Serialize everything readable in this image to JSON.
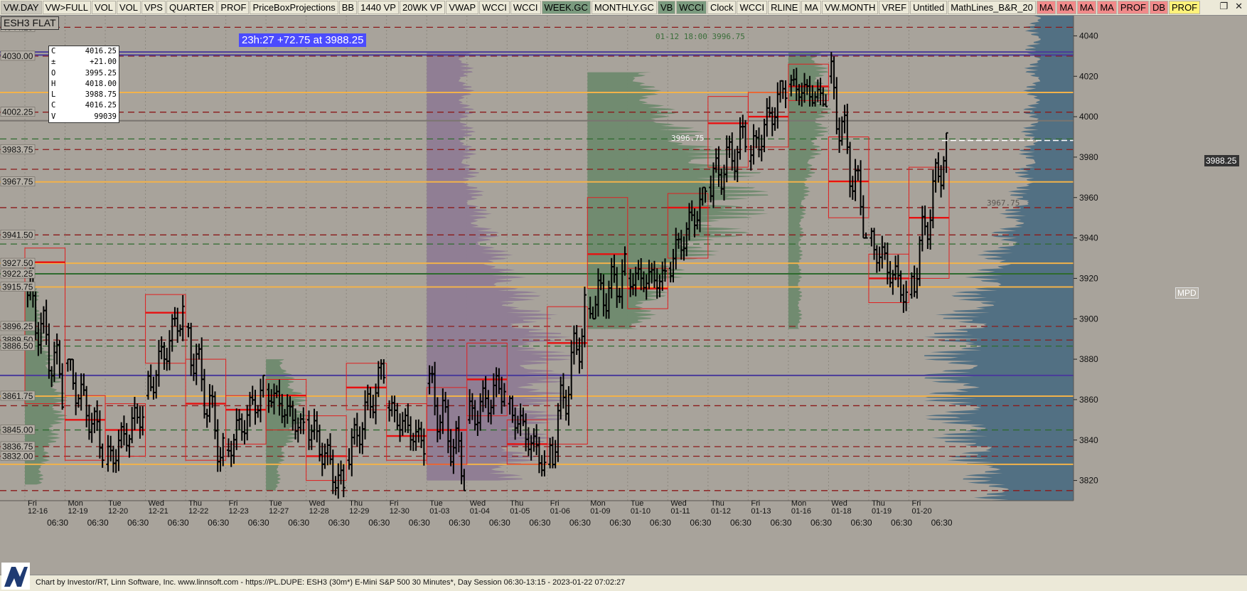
{
  "toolbar": {
    "buttons": [
      {
        "label": "VW.DAY",
        "state": "sel"
      },
      {
        "label": "VW>FULL",
        "state": ""
      },
      {
        "label": "VOL",
        "state": ""
      },
      {
        "label": "VOL",
        "state": ""
      },
      {
        "label": "VPS",
        "state": ""
      },
      {
        "label": "QUARTER",
        "state": ""
      },
      {
        "label": "PROF",
        "state": ""
      },
      {
        "label": "PriceBoxProjections",
        "state": ""
      },
      {
        "label": "BB",
        "state": ""
      },
      {
        "label": "1440 VP",
        "state": ""
      },
      {
        "label": "20WK VP",
        "state": ""
      },
      {
        "label": "VWAP",
        "state": ""
      },
      {
        "label": "WCCI",
        "state": ""
      },
      {
        "label": "WCCI",
        "state": ""
      },
      {
        "label": "WEEK.GC",
        "state": "on"
      },
      {
        "label": "MONTHLY.GC",
        "state": ""
      },
      {
        "label": "VB",
        "state": "on"
      },
      {
        "label": "WCCI",
        "state": "on"
      },
      {
        "label": "Clock",
        "state": ""
      },
      {
        "label": "WCCI",
        "state": ""
      },
      {
        "label": "RLINE",
        "state": ""
      },
      {
        "label": "MA",
        "state": ""
      },
      {
        "label": "VW.MONTH",
        "state": ""
      },
      {
        "label": "VREF",
        "state": ""
      },
      {
        "label": "Untitled",
        "state": ""
      },
      {
        "label": "MathLines_B&R_20",
        "state": ""
      },
      {
        "label": "MA",
        "state": "red"
      },
      {
        "label": "MA",
        "state": "red"
      },
      {
        "label": "MA",
        "state": "red"
      },
      {
        "label": "MA",
        "state": "red"
      },
      {
        "label": "PROF",
        "state": "red"
      },
      {
        "label": "DB",
        "state": "red"
      },
      {
        "label": "PROF",
        "state": "yel"
      }
    ],
    "window_icons": [
      "restore-icon",
      "close-icon"
    ],
    "window_glyphs": [
      "❐",
      "✕"
    ]
  },
  "symbol": "ESH3 FLAT",
  "banner": "23h:27  +72.75 at 3988.25",
  "header_note": "01-12 18:00 3996.75",
  "poc_note": "3996.75",
  "hl_note": "3967.75",
  "mpd_label": "MPD",
  "last_price": "3988.25",
  "info_box": [
    {
      "k": "C",
      "v": "4016.25"
    },
    {
      "k": "±",
      "v": "+21.00"
    },
    {
      "k": "O",
      "v": "3995.25"
    },
    {
      "k": "H",
      "v": "4018.00"
    },
    {
      "k": "L",
      "v": "3988.75"
    },
    {
      "k": "C",
      "v": "4016.25"
    },
    {
      "k": "V",
      "v": "99039"
    }
  ],
  "footer": "Chart by Investor/RT, Linn Software, Inc. www.linnsoft.com - https://PL.DUPE: ESH3 (30m*) E-Mini S&P 500 30 Minutes*, Day Session 06:30-13:15 - 2023-01-22 07:02:27",
  "colors": {
    "background": "#a8a39b",
    "candle": "#000000",
    "poc_red": "#e81010",
    "value_area_orange": "#f2b24a",
    "purple": "#4a3b9a",
    "profile_purple": "#8e7c94",
    "profile_green": "#6e8a6e",
    "profile_blue": "#4d6e82"
  },
  "chart_data": {
    "type": "candlestick",
    "title": "ESH3 (30m*) E-Mini S&P 500 30 Minutes*",
    "ylim": [
      3810,
      4050
    ],
    "y_ticks": [
      3820,
      3840,
      3860,
      3880,
      3900,
      3920,
      3940,
      3960,
      3980,
      4000,
      4020,
      4040
    ],
    "left_price_labels": [
      {
        "text": "4044.25",
        "y": 4044.25
      },
      {
        "text": "4030.00",
        "y": 4030.0
      },
      {
        "text": "4002.25",
        "y": 4002.25
      },
      {
        "text": "3983.75",
        "y": 3983.75
      },
      {
        "text": "3967.75",
        "y": 3967.75
      },
      {
        "text": "3941.50",
        "y": 3941.5
      },
      {
        "text": "3927.50",
        "y": 3927.5
      },
      {
        "text": "3922.25",
        "y": 3922.25
      },
      {
        "text": "3915.75",
        "y": 3915.75
      },
      {
        "text": "3896.25",
        "y": 3896.25
      },
      {
        "text": "3889.50",
        "y": 3889.5
      },
      {
        "text": "3886.50",
        "y": 3886.5
      },
      {
        "text": "3861.75",
        "y": 3861.75
      },
      {
        "text": "3845.00",
        "y": 3845.0
      },
      {
        "text": "3836.75",
        "y": 3836.75
      },
      {
        "text": "3832.00",
        "y": 3832.0
      }
    ],
    "days": [
      {
        "day": "Fri",
        "date": "12-16",
        "o": 3915,
        "c": 3868,
        "lo": 3855,
        "hi": 3945,
        "poc": 3928,
        "vah": 3935,
        "val": 3858
      },
      {
        "day": "Mon",
        "date": "12-19",
        "o": 3878,
        "c": 3838,
        "lo": 3820,
        "hi": 3880,
        "poc": 3850,
        "vah": 3862,
        "val": 3830
      },
      {
        "day": "Tue",
        "date": "12-20",
        "o": 3828,
        "c": 3855,
        "lo": 3815,
        "hi": 3865,
        "poc": 3845,
        "vah": 3858,
        "val": 3832
      },
      {
        "day": "Wed",
        "date": "12-21",
        "o": 3862,
        "c": 3905,
        "lo": 3860,
        "hi": 3915,
        "poc": 3903,
        "vah": 3912,
        "val": 3878
      },
      {
        "day": "Thu",
        "date": "12-22",
        "o": 3896,
        "c": 3832,
        "lo": 3812,
        "hi": 3898,
        "poc": 3858,
        "vah": 3880,
        "val": 3830
      },
      {
        "day": "Fri",
        "date": "12-23",
        "o": 3835,
        "c": 3865,
        "lo": 3822,
        "hi": 3872,
        "poc": 3855,
        "vah": 3862,
        "val": 3838
      },
      {
        "day": "Tue",
        "date": "12-27",
        "o": 3865,
        "c": 3845,
        "lo": 3838,
        "hi": 3873,
        "poc": 3862,
        "vah": 3870,
        "val": 3845
      },
      {
        "day": "Wed",
        "date": "12-28",
        "o": 3850,
        "c": 3815,
        "lo": 3808,
        "hi": 3862,
        "poc": 3832,
        "vah": 3852,
        "val": 3820
      },
      {
        "day": "Thu",
        "date": "12-29",
        "o": 3830,
        "c": 3875,
        "lo": 3820,
        "hi": 3880,
        "poc": 3866,
        "vah": 3878,
        "val": 3855
      },
      {
        "day": "Fri",
        "date": "12-30",
        "o": 3856,
        "c": 3838,
        "lo": 3825,
        "hi": 3862,
        "poc": 3842,
        "vah": 3858,
        "val": 3830
      },
      {
        "day": "Tue",
        "date": "01-03",
        "o": 3868,
        "c": 3826,
        "lo": 3815,
        "hi": 3900,
        "poc": 3845,
        "vah": 3866,
        "val": 3828
      },
      {
        "day": "Wed",
        "date": "01-04",
        "o": 3850,
        "c": 3868,
        "lo": 3838,
        "hi": 3895,
        "poc": 3870,
        "vah": 3888,
        "val": 3852
      },
      {
        "day": "Thu",
        "date": "01-05",
        "o": 3858,
        "c": 3828,
        "lo": 3822,
        "hi": 3862,
        "poc": 3838,
        "vah": 3850,
        "val": 3828
      },
      {
        "day": "Fri",
        "date": "01-06",
        "o": 3828,
        "c": 3902,
        "lo": 3826,
        "hi": 3918,
        "poc": 3888,
        "vah": 3906,
        "val": 3838
      },
      {
        "day": "Mon",
        "date": "01-09",
        "o": 3905,
        "c": 3922,
        "lo": 3900,
        "hi": 3972,
        "poc": 3932,
        "vah": 3960,
        "val": 3915
      },
      {
        "day": "Tue",
        "date": "01-10",
        "o": 3920,
        "c": 3920,
        "lo": 3896,
        "hi": 3930,
        "poc": 3915,
        "vah": 3925,
        "val": 3905
      },
      {
        "day": "Wed",
        "date": "01-11",
        "o": 3925,
        "c": 3962,
        "lo": 3918,
        "hi": 3965,
        "poc": 3955,
        "vah": 3962,
        "val": 3930
      },
      {
        "day": "Thu",
        "date": "01-12",
        "o": 3965,
        "c": 3990,
        "lo": 3948,
        "hi": 4018,
        "poc": 3996.75,
        "vah": 4010,
        "val": 3975
      },
      {
        "day": "Fri",
        "date": "01-13",
        "o": 3978,
        "c": 4016,
        "lo": 3966,
        "hi": 4018,
        "poc": 4000,
        "vah": 4012,
        "val": 3985
      },
      {
        "day": "Mon",
        "date": "01-16",
        "o": 4016,
        "c": 4008,
        "lo": 4005,
        "hi": 4034,
        "poc": 4015,
        "vah": 4026,
        "val": 4008
      },
      {
        "day": "Wed",
        "date": "01-18",
        "o": 4020,
        "c": 3945,
        "lo": 3940,
        "hi": 4032,
        "poc": 3968,
        "vah": 3990,
        "val": 3950
      },
      {
        "day": "Thu",
        "date": "01-19",
        "o": 3940,
        "c": 3912,
        "lo": 3900,
        "hi": 3945,
        "poc": 3920,
        "vah": 3932,
        "val": 3908
      },
      {
        "day": "Fri",
        "date": "01-20",
        "o": 3912,
        "c": 3988.25,
        "lo": 3910,
        "hi": 3992,
        "poc": 3950,
        "vah": 3975,
        "val": 3920
      }
    ],
    "x_time_label": "06:30",
    "horizontal_levels": [
      {
        "y": 4044.25,
        "color": "#8b1a1a",
        "style": "dash"
      },
      {
        "y": 4030,
        "color": "#8b1a1a",
        "style": "dash"
      },
      {
        "y": 4032,
        "color": "#4a3b9a",
        "style": "solid"
      },
      {
        "y": 4030.5,
        "color": "#4a3b9a",
        "style": "solid"
      },
      {
        "y": 4012,
        "color": "#f2b24a",
        "style": "solid"
      },
      {
        "y": 4002.25,
        "color": "#8b1a1a",
        "style": "dash"
      },
      {
        "y": 3998,
        "color": "#7a7570",
        "style": "solid"
      },
      {
        "y": 3989,
        "color": "#2e6b2e",
        "style": "dash"
      },
      {
        "y": 3983.75,
        "color": "#8b1a1a",
        "style": "dash"
      },
      {
        "y": 3974,
        "color": "#8b1a1a",
        "style": "dash"
      },
      {
        "y": 3967.75,
        "color": "#f2b24a",
        "style": "solid"
      },
      {
        "y": 3955,
        "color": "#8b1a1a",
        "style": "dash"
      },
      {
        "y": 3941.5,
        "color": "#8b1a1a",
        "style": "dash"
      },
      {
        "y": 3937,
        "color": "#2e6b2e",
        "style": "dash"
      },
      {
        "y": 3927.5,
        "color": "#f2b24a",
        "style": "solid"
      },
      {
        "y": 3922.25,
        "color": "#2e6b2e",
        "style": "solid"
      },
      {
        "y": 3915.75,
        "color": "#f2b24a",
        "style": "solid"
      },
      {
        "y": 3896.25,
        "color": "#8b1a1a",
        "style": "dash"
      },
      {
        "y": 3889.5,
        "color": "#8b1a1a",
        "style": "dash"
      },
      {
        "y": 3886.5,
        "color": "#2e6b2e",
        "style": "dash"
      },
      {
        "y": 3872,
        "color": "#4a3b9a",
        "style": "solid"
      },
      {
        "y": 3861.75,
        "color": "#f2b24a",
        "style": "solid"
      },
      {
        "y": 3857,
        "color": "#8b1a1a",
        "style": "dash"
      },
      {
        "y": 3845,
        "color": "#2e6b2e",
        "style": "dash"
      },
      {
        "y": 3836.75,
        "color": "#8b1a1a",
        "style": "dash"
      },
      {
        "y": 3832,
        "color": "#8b1a1a",
        "style": "dash"
      },
      {
        "y": 3828,
        "color": "#f2b24a",
        "style": "solid"
      },
      {
        "y": 3815,
        "color": "#8b1a1a",
        "style": "dash"
      }
    ],
    "profiles": [
      {
        "name": "20WK VP",
        "x_from": "01-03",
        "x_to": "01-09",
        "color": "#8e7c94",
        "lo": 3820,
        "hi": 4032,
        "peak": 3872,
        "w": 0.22
      },
      {
        "name": "week-0109",
        "x_from": "01-09",
        "x_to": "01-16",
        "color": "#6e8a6e",
        "lo": 3895,
        "hi": 4022,
        "peak": 3960,
        "w": 0.12
      },
      {
        "name": "week-1216",
        "x_from": "12-16",
        "x_to": "12-19",
        "color": "#6e8a6e",
        "lo": 3818,
        "hi": 3915,
        "peak": 3858,
        "w": 0.14
      },
      {
        "name": "week-1227",
        "x_from": "12-27",
        "x_to": "12-28",
        "color": "#6e8a6e",
        "lo": 3815,
        "hi": 3880,
        "peak": 3855,
        "w": 0.09
      },
      {
        "name": "week-0116",
        "x_from": "01-16",
        "x_to": "01-18",
        "color": "#6e8a6e",
        "lo": 3895,
        "hi": 4032,
        "peak": 4008,
        "w": 0.12
      },
      {
        "name": "right-vp",
        "x_from": "right",
        "x_to": "right",
        "color": "#4d6e82",
        "lo": 3810,
        "hi": 4050,
        "peak": 3870,
        "w": 0.28
      }
    ]
  }
}
